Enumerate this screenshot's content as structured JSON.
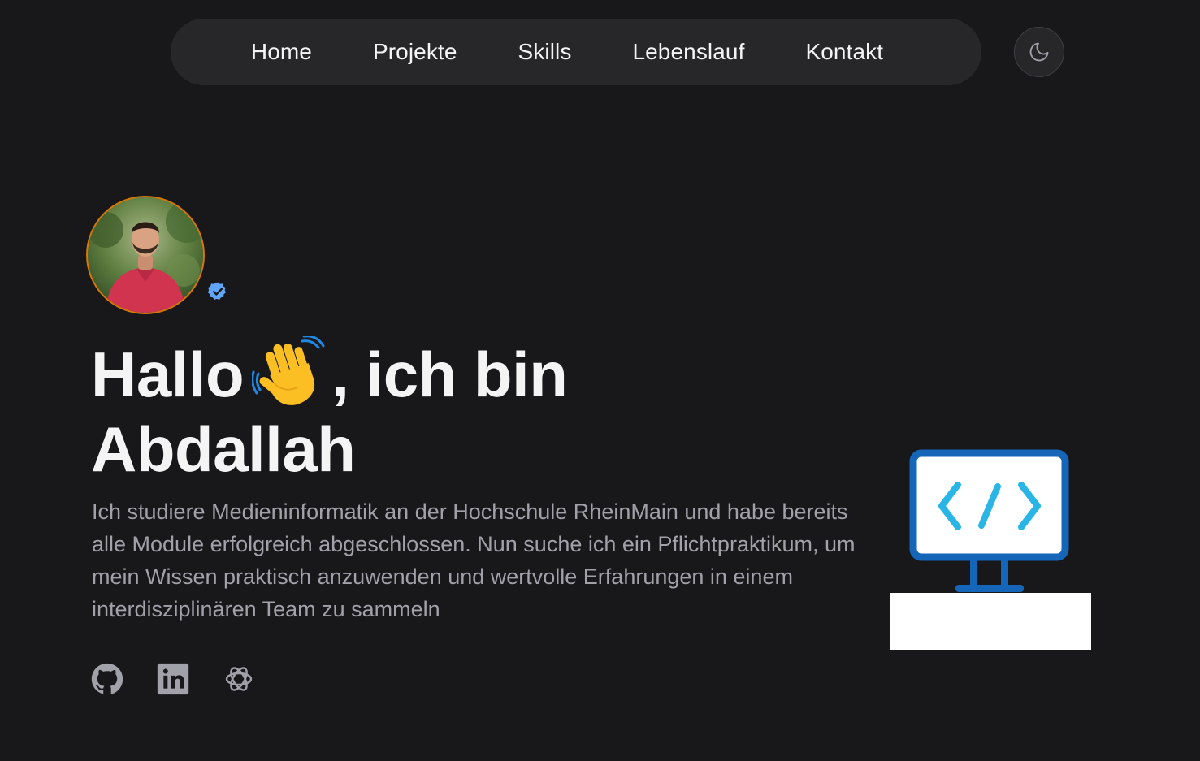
{
  "nav": {
    "items": [
      {
        "label": "Home"
      },
      {
        "label": "Projekte"
      },
      {
        "label": "Skills"
      },
      {
        "label": "Lebenslauf"
      },
      {
        "label": "Kontakt"
      }
    ],
    "theme_toggle_icon": "moon-icon"
  },
  "hero": {
    "greeting_part1": "Hallo",
    "greeting_emoji": "waving-hand-icon",
    "greeting_part2": ", ich bin",
    "name": "Abdallah",
    "description": "Ich studiere Medieninformatik an der Hochschule RheinMain und habe bereits alle Module erfolgreich abgeschlossen. Nun suche ich ein Pflichtpraktikum, um mein Wissen praktisch anzuwenden und wertvolle Erfahrungen in einem interdisziplinären Team zu sammeln"
  },
  "avatar": {
    "badge_icon": "verified-badge-icon"
  },
  "socials": [
    {
      "icon": "github-icon"
    },
    {
      "icon": "linkedin-icon"
    },
    {
      "icon": "openai-icon"
    }
  ],
  "illustration": {
    "icon": "code-monitor-icon"
  },
  "colors": {
    "background": "#18181b",
    "nav_background": "#27272a",
    "text_primary": "#f4f4f5",
    "text_secondary": "#a1a1aa",
    "avatar_border": "#d97706",
    "verified": "#60a5fa",
    "monitor_frame": "#1565b8",
    "code_accent": "#29b6e6"
  }
}
